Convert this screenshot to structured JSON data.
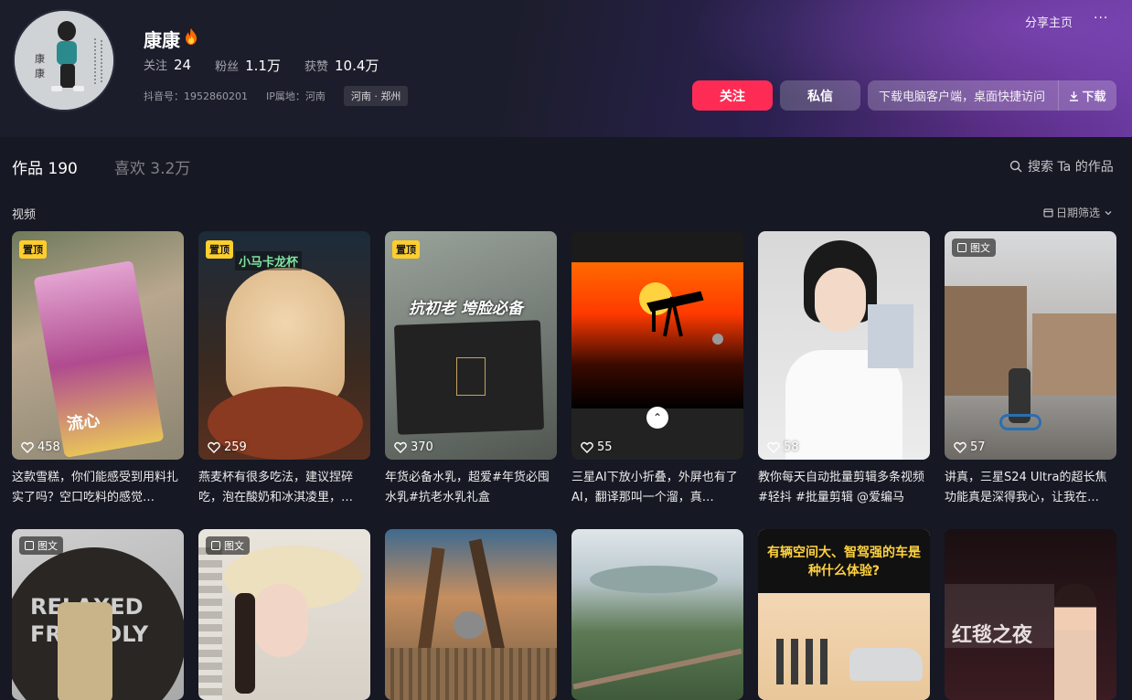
{
  "profile": {
    "nickname": "康康",
    "stats": [
      {
        "label": "关注",
        "value": "24"
      },
      {
        "label": "粉丝",
        "value": "1.1万"
      },
      {
        "label": "获赞",
        "value": "10.4万"
      }
    ],
    "douyin_id": "抖音号：1952860201",
    "ip_location": "IP属地：河南",
    "location_tag": "河南 · 郑州",
    "avatar_text": "康康"
  },
  "header": {
    "share_label": "分享主页",
    "more_label": "···"
  },
  "actions": {
    "follow_label": "关注",
    "message_label": "私信",
    "download_prompt": "下载电脑客户端，桌面快捷访问",
    "download_label": "下载"
  },
  "tabs": [
    {
      "label": "作品 190"
    },
    {
      "label": "喜欢 3.2万"
    }
  ],
  "search": {
    "label": "搜索 Ta 的作品"
  },
  "section": {
    "label": "视频",
    "date_filter": "日期筛选"
  },
  "colors": {
    "accent": "#fe2c55",
    "pin_badge": "#fece2c"
  },
  "videos": [
    {
      "pinned": true,
      "badge": "置顶",
      "likes": "458",
      "caption": "这款雪糕，你们能感受到用料扎实了吗？空口吃料的感觉…",
      "overlay": "流心"
    },
    {
      "pinned": true,
      "badge": "置顶",
      "likes": "259",
      "caption": "燕麦杯有很多吃法，建议捏碎吃，泡在酸奶和冰淇凌里，…",
      "overlay": "小马卡龙杯"
    },
    {
      "pinned": true,
      "badge": "置顶",
      "likes": "370",
      "caption": "年货必备水乳，超爱#年货必囤水乳#抗老水乳礼盒",
      "overlay": "抗初老 垮脸必备"
    },
    {
      "likes": "55",
      "caption": "三星AI下放小折叠，外屏也有了AI，翻译那叫一个溜，真…"
    },
    {
      "likes": "58",
      "caption": "教你每天自动批量剪辑多条视频#轻抖 #批量剪辑 @爱编马"
    },
    {
      "badge": "图文",
      "likes": "57",
      "caption": "讲真，三星S24 Ultra的超长焦功能真是深得我心，让我在…"
    },
    {
      "badge": "图文",
      "overlay": "RELAXED FRIENDLY"
    },
    {
      "badge": "图文"
    },
    {},
    {},
    {
      "overlay": "有辆空间大、智驾强的车是种什么体验?"
    },
    {
      "overlay": "红毯之夜"
    }
  ]
}
